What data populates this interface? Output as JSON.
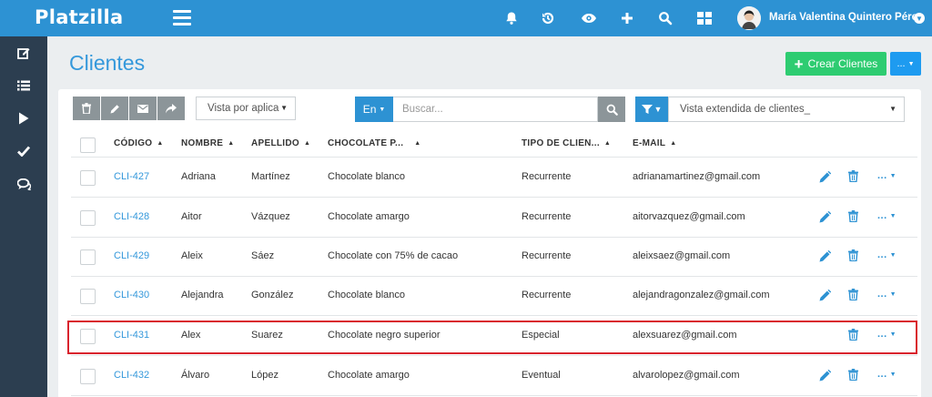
{
  "app": {
    "logo": "Platzilla"
  },
  "header": {
    "user_name": "María Valentina Quintero Pérez"
  },
  "page": {
    "title": "Clientes"
  },
  "actions": {
    "create_label": "Crear Clientes",
    "more_label": "..."
  },
  "toolbar": {
    "view_select": "Vista por aplica",
    "search_lang": "En",
    "search_placeholder": "Buscar...",
    "view_extended": "Vista extendida de clientes_"
  },
  "table": {
    "columns": [
      "CÓDIGO",
      "NOMBRE",
      "APELLIDO",
      "CHOCOLATE P...",
      "TIPO DE CLIEN...",
      "E-MAIL"
    ],
    "rows": [
      {
        "code": "CLI-427",
        "name": "Adriana",
        "surname": "Martínez",
        "chocolate": "Chocolate blanco",
        "type": "Recurrente",
        "email": "adrianamartinez@gmail.com",
        "edit": true
      },
      {
        "code": "CLI-428",
        "name": "Aitor",
        "surname": "Vázquez",
        "chocolate": "Chocolate amargo",
        "type": "Recurrente",
        "email": "aitorvazquez@gmail.com",
        "edit": true
      },
      {
        "code": "CLI-429",
        "name": "Aleix",
        "surname": "Sáez",
        "chocolate": "Chocolate con 75% de cacao",
        "type": "Recurrente",
        "email": "aleixsaez@gmail.com",
        "edit": true
      },
      {
        "code": "CLI-430",
        "name": "Alejandra",
        "surname": "González",
        "chocolate": "Chocolate blanco",
        "type": "Recurrente",
        "email": "alejandragonzalez@gmail.com",
        "edit": true
      },
      {
        "code": "CLI-431",
        "name": "Alex",
        "surname": "Suarez",
        "chocolate": "Chocolate negro superior",
        "type": "Especial",
        "email": "alexsuarez@gmail.com",
        "edit": false
      },
      {
        "code": "CLI-432",
        "name": "Álvaro",
        "surname": "López",
        "chocolate": "Chocolate amargo",
        "type": "Eventual",
        "email": "alvarolopez@gmail.com",
        "edit": true
      }
    ],
    "row_more": "..."
  },
  "colors": {
    "topbar": "#2d92d3",
    "sidebar": "#2c3e50",
    "accent": "#3498db",
    "create": "#2ecc71",
    "highlight": "#d9232d"
  },
  "icons": {
    "topbar": [
      "bell-icon",
      "history-icon",
      "eye-icon",
      "plus-icon",
      "search-icon",
      "grid-icon"
    ],
    "sidebar": [
      "edit-icon",
      "list-icon",
      "play-icon",
      "check-icon",
      "chat-icon"
    ],
    "toolbar": [
      "trash-icon",
      "pencil-icon",
      "envelope-icon",
      "share-icon"
    ]
  }
}
